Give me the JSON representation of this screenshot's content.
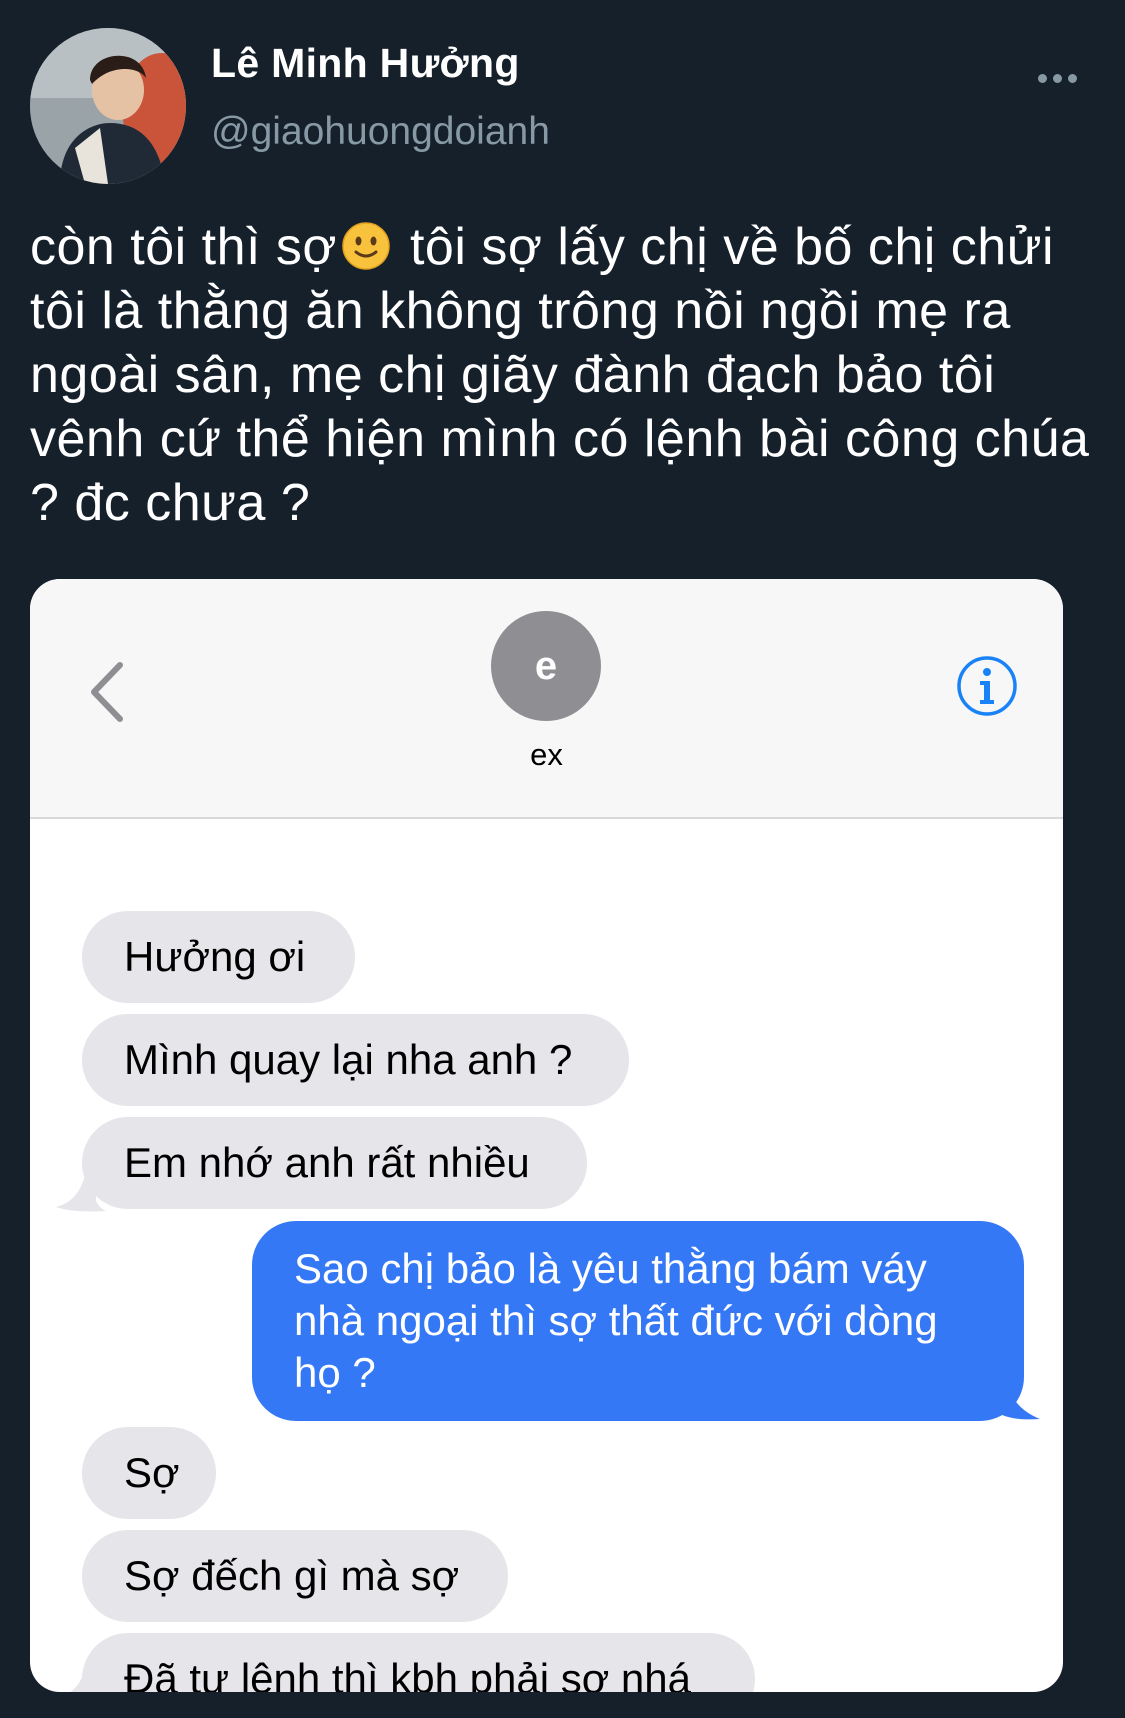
{
  "tweet": {
    "display_name": "Lê Minh Hưởng",
    "handle": "@giaohuongdoianh",
    "text_before_emoji": "còn tôi thì sợ",
    "emoji_icon": "slightly-smiling-face",
    "text_after_emoji": " tôi sợ lấy chị về bố chị chửi tôi là thằng ăn không trông nồi ngồi mẹ ra ngoài sân, mẹ chị giãy đành đạch bảo tôi vênh cứ thể hiện mình có lệnh bài công chúa ? đc chưa ?"
  },
  "screenshot": {
    "contact_initial": "e",
    "contact_name": "ex",
    "messages": [
      {
        "side": "received",
        "text": "Hưởng ơi"
      },
      {
        "side": "received",
        "text": "Mình quay lại nha anh ?"
      },
      {
        "side": "received",
        "text": "Em nhớ anh rất nhiều"
      },
      {
        "side": "sent",
        "text": "Sao chị bảo là yêu thằng bám váy nhà ngoại thì sợ thất đức với dòng họ ?"
      },
      {
        "side": "received",
        "text": "Sợ"
      },
      {
        "side": "received",
        "text": "Sợ đếch gì mà sợ"
      },
      {
        "side": "received",
        "text": "Đã tư lệnh thì kbh phải sợ nhá"
      }
    ]
  },
  "colors": {
    "background": "#15202b",
    "secondary_text": "#8899a6",
    "sent_bubble": "#3478f6",
    "received_bubble": "#e5e5ea",
    "ios_blue": "#1a82f7"
  }
}
